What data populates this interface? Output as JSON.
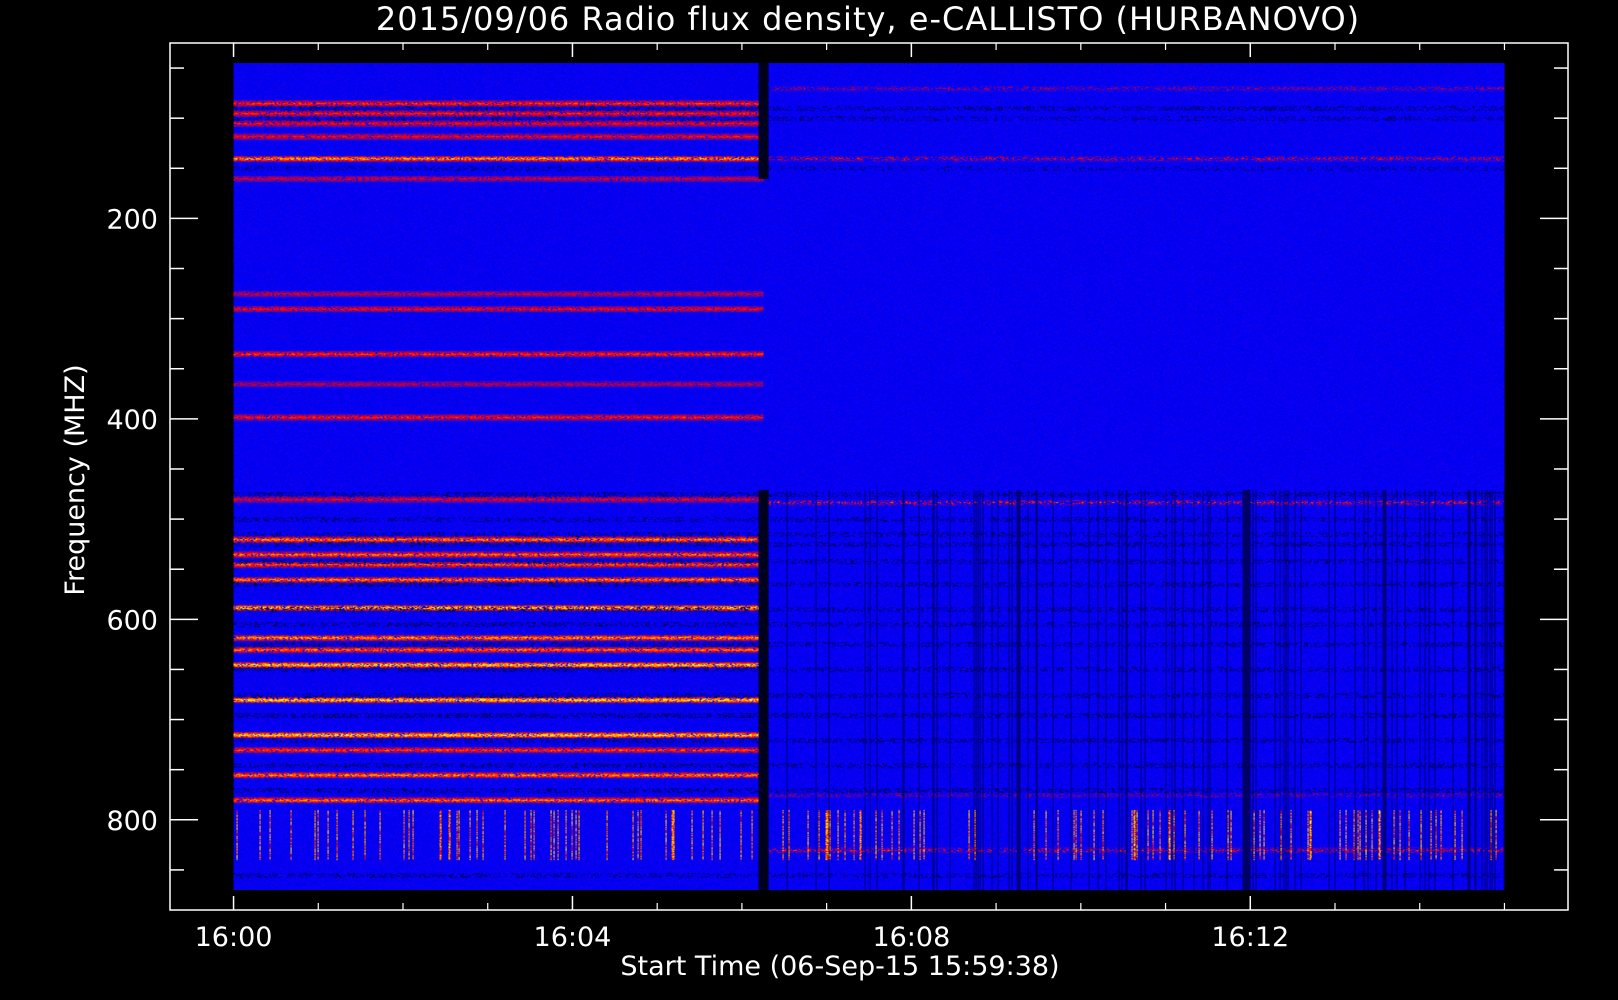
{
  "chart_data": {
    "type": "heatmap",
    "title": "2015/09/06  Radio flux density, e-CALLISTO (HURBANOVO)",
    "xlabel": "Start Time (06-Sep-15 15:59:38)",
    "ylabel": "Frequency (MHZ)",
    "x_ticks": [
      "16:00",
      "16:04",
      "16:08",
      "16:12"
    ],
    "x_tick_minutes": [
      0,
      4,
      8,
      12
    ],
    "y_ticks": [
      200,
      400,
      600,
      800
    ],
    "xlim_minutes": [
      -0.75,
      15.75
    ],
    "data_time_range_minutes": [
      0,
      15
    ],
    "ylim": [
      25,
      890
    ],
    "data_freq_range_mhz": [
      45,
      870
    ],
    "y_inverted": true,
    "colormap": [
      "#000000",
      "#0000ff",
      "#ff0000",
      "#ffff00",
      "#ffffff"
    ],
    "background_color": "#0000ff",
    "transition_minute": 6.25,
    "interference_column_minute": 11.95,
    "bands_before": [
      {
        "freq": 85,
        "level": 0.55
      },
      {
        "freq": 95,
        "level": 0.5
      },
      {
        "freq": 105,
        "level": 0.45
      },
      {
        "freq": 118,
        "level": 0.45
      },
      {
        "freq": 140,
        "level": 0.8
      },
      {
        "freq": 160,
        "level": 0.35
      },
      {
        "freq": 275,
        "level": 0.35
      },
      {
        "freq": 290,
        "level": 0.45
      },
      {
        "freq": 335,
        "level": 0.55
      },
      {
        "freq": 365,
        "level": 0.3
      },
      {
        "freq": 398,
        "level": 0.5
      },
      {
        "freq": 480,
        "level": 0.4
      },
      {
        "freq": 520,
        "level": 0.75
      },
      {
        "freq": 535,
        "level": 0.7
      },
      {
        "freq": 545,
        "level": 0.65
      },
      {
        "freq": 560,
        "level": 0.75
      },
      {
        "freq": 588,
        "level": 0.95
      },
      {
        "freq": 618,
        "level": 0.8
      },
      {
        "freq": 630,
        "level": 0.7
      },
      {
        "freq": 645,
        "level": 0.95
      },
      {
        "freq": 680,
        "level": 0.97
      },
      {
        "freq": 715,
        "level": 0.97
      },
      {
        "freq": 730,
        "level": 0.6
      },
      {
        "freq": 755,
        "level": 0.75
      },
      {
        "freq": 780,
        "level": 0.7
      }
    ],
    "bands_after": [
      {
        "freq": 70,
        "level": 0.35
      },
      {
        "freq": 140,
        "level": 0.5
      },
      {
        "freq": 483,
        "level": 0.6
      },
      {
        "freq": 775,
        "level": 0.3
      },
      {
        "freq": 830,
        "level": 0.55
      }
    ],
    "dark_bands": [
      {
        "freq": 90,
        "level": 0.6
      },
      {
        "freq": 100,
        "level": 0.5
      },
      {
        "freq": 150,
        "level": 0.4
      },
      {
        "freq": 475,
        "level": 0.6
      },
      {
        "freq": 500,
        "level": 0.5
      },
      {
        "freq": 515,
        "level": 0.5
      },
      {
        "freq": 525,
        "level": 0.6
      },
      {
        "freq": 542,
        "level": 0.6
      },
      {
        "freq": 565,
        "level": 0.6
      },
      {
        "freq": 590,
        "level": 0.6
      },
      {
        "freq": 605,
        "level": 0.6
      },
      {
        "freq": 625,
        "level": 0.6
      },
      {
        "freq": 650,
        "level": 0.6
      },
      {
        "freq": 675,
        "level": 0.6
      },
      {
        "freq": 695,
        "level": 0.7
      },
      {
        "freq": 720,
        "level": 0.6
      },
      {
        "freq": 745,
        "level": 0.6
      },
      {
        "freq": 770,
        "level": 0.6
      },
      {
        "freq": 855,
        "level": 0.5
      }
    ]
  }
}
